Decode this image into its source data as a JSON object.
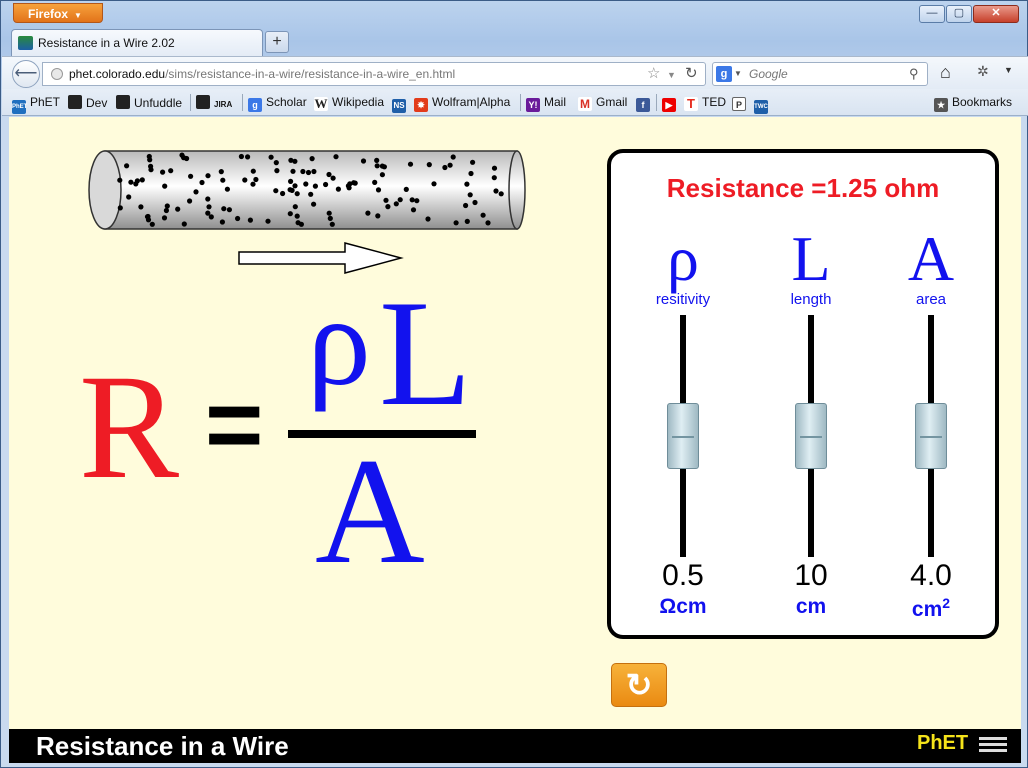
{
  "browser": {
    "app_button": "Firefox",
    "tab_title": "Resistance in a Wire 2.02",
    "url_host": "phet.colorado.edu",
    "url_path": "/sims/resistance-in-a-wire/resistance-in-a-wire_en.html",
    "search_placeholder": "Google",
    "bookmarks": [
      {
        "label": "PhET",
        "icon": "phet-icon",
        "color": "#1f6fbf"
      },
      {
        "label": "Dev",
        "icon": "cu-icon",
        "color": "#222"
      },
      {
        "label": "Unfuddle",
        "icon": "unfuddle-icon",
        "color": "#222"
      },
      {
        "label": "JIRA",
        "icon": "cu-jira-icon",
        "color": "#222"
      },
      {
        "label": "Scholar",
        "icon": "google-icon",
        "color": "#3b78e7"
      },
      {
        "label": "Wikipedia",
        "icon": "wikipedia-icon",
        "color": "#444"
      },
      {
        "label": "Wolfram|Alpha",
        "icon": "wolfram-icon",
        "color": "#e23b1a"
      },
      {
        "label": "Mail",
        "icon": "yahoo-icon",
        "color": "#6a1b9a"
      },
      {
        "label": "Gmail",
        "icon": "gmail-icon",
        "color": "#d93025"
      },
      {
        "label": "TED",
        "icon": "ted-icon",
        "color": "#e62b1e"
      },
      {
        "label": "Bookmarks",
        "icon": "bookmarks-icon",
        "color": "#555"
      }
    ],
    "bookmark_icon_text": {
      "phet": "PhET",
      "jira": "JIRA",
      "ns": "NS",
      "twc": "TWC"
    }
  },
  "sim": {
    "formula": {
      "R": "R",
      "equals": "=",
      "rho": "ρ",
      "L": "L",
      "A": "A"
    },
    "panel": {
      "resistance_text": "Resistance =1.25 ohm",
      "sliders": [
        {
          "symbol": "ρ",
          "label": "resitivity",
          "value": "0.5",
          "unit": "Ωcm",
          "level": 0.5
        },
        {
          "symbol": "L",
          "label": "length",
          "value": "10",
          "unit": "cm",
          "level": 0.5
        },
        {
          "symbol": "A",
          "label": "area",
          "value": "4.0",
          "unit": "cm",
          "unit_sup": "2",
          "level": 0.5
        }
      ]
    },
    "reset_icon": "↻",
    "title": "Resistance in a Wire",
    "logo": "PhET",
    "colors": {
      "R": "#ee1c25",
      "formula_blue": "#1212ee",
      "reset": "#ea8a12",
      "logo": "#f5e31a"
    }
  }
}
